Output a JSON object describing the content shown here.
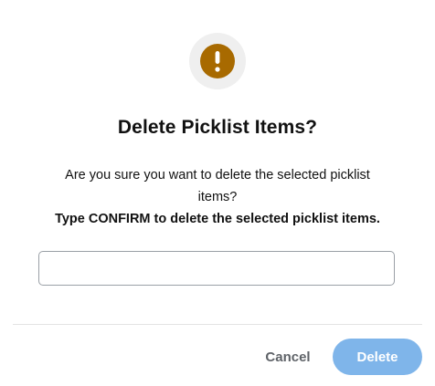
{
  "dialog": {
    "icon": "exclamation-warning-icon",
    "accent_color": "#a86a00",
    "title": "Delete Picklist Items?",
    "message_line1": "Are you sure you want to delete the selected picklist",
    "message_line2": "items?",
    "instruction": "Type CONFIRM to delete the selected picklist items.",
    "input": {
      "value": "",
      "placeholder": ""
    },
    "cancel_label": "Cancel",
    "delete_label": "Delete",
    "delete_color": "#7fb5ea"
  }
}
